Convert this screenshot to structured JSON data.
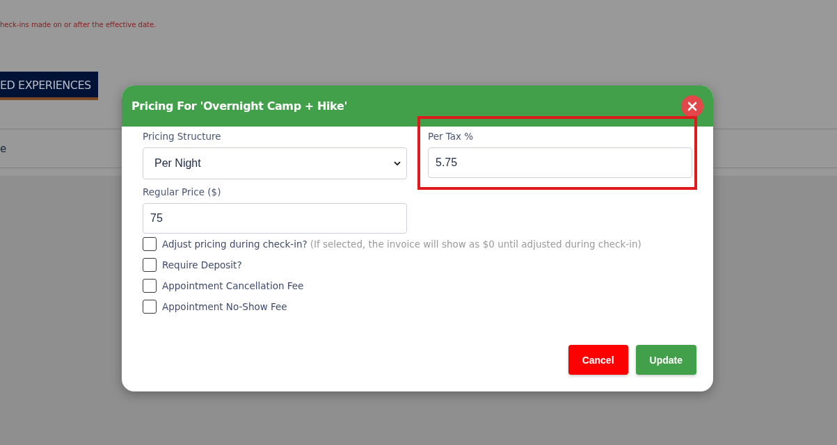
{
  "background": {
    "notice": "heck-ins made on or after the effective date.",
    "tab": {
      "label": "ED EXPERIENCES",
      "selected": true
    },
    "row_text": "e"
  },
  "modal": {
    "title": "Pricing For 'Overnight Camp + Hike'",
    "pricing_structure": {
      "label": "Pricing Structure",
      "value": "Per Night"
    },
    "tax": {
      "label": "Per Tax %",
      "value": "5.75",
      "highlighted": true
    },
    "regular_price": {
      "label": "Regular Price ($)",
      "value": "75"
    },
    "options": [
      {
        "label": "Adjust pricing during check-in?",
        "hint": "(If selected, the invoice will show as $0 until adjusted during check-in)",
        "checked": false
      },
      {
        "label": "Require Deposit?",
        "checked": false
      },
      {
        "label": "Appointment Cancellation Fee",
        "checked": false
      },
      {
        "label": "Appointment No-Show Fee",
        "checked": false
      }
    ],
    "buttons": [
      {
        "label": "Cancel",
        "kind": "danger"
      },
      {
        "label": "Update",
        "kind": "primary"
      }
    ]
  }
}
